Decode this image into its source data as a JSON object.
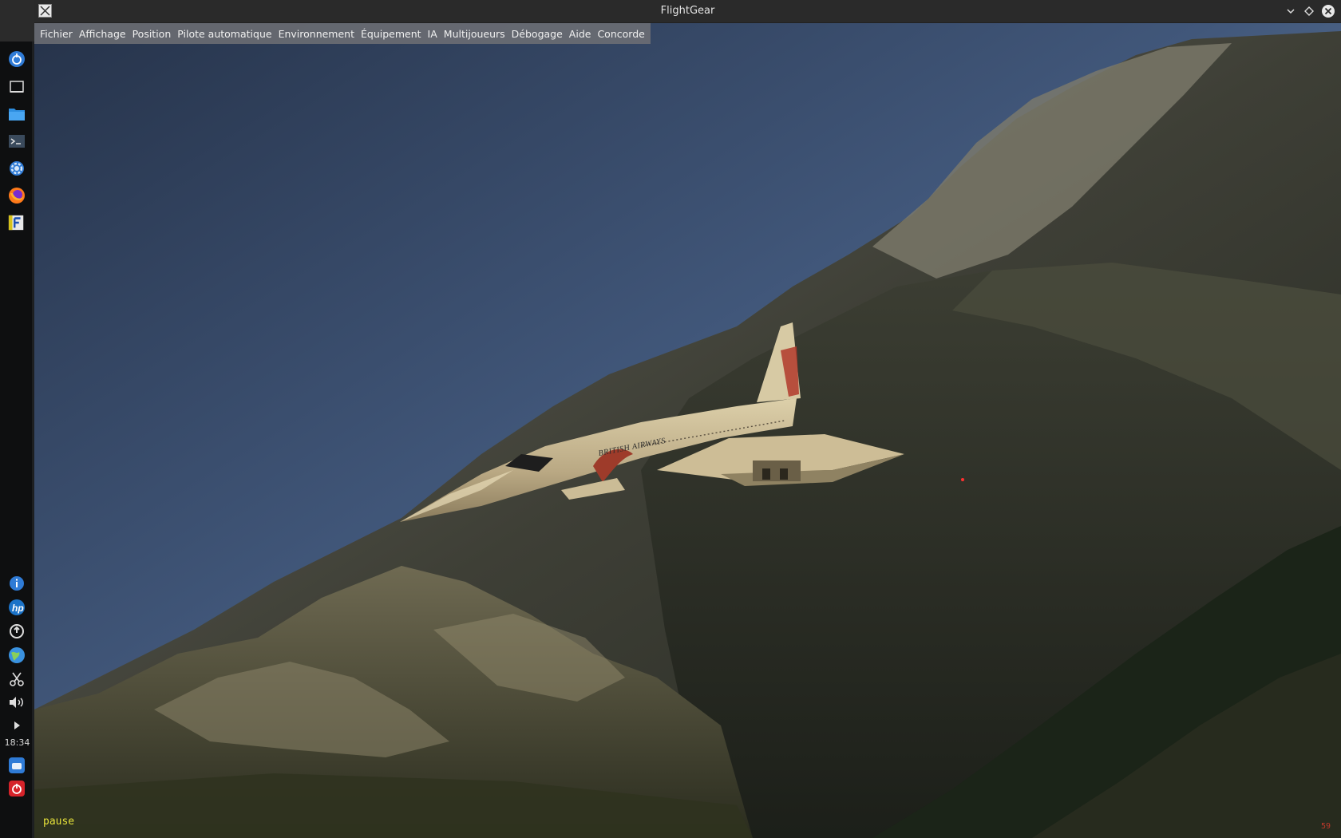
{
  "window": {
    "title": "FlightGear",
    "controls": [
      "minimize-icon",
      "maximize-icon",
      "close-icon"
    ]
  },
  "menubar": {
    "items": [
      "Fichier",
      "Affichage",
      "Position",
      "Pilote automatique",
      "Environnement",
      "Équipement",
      "IA",
      "Multijoueurs",
      "Débogage",
      "Aide",
      "Concorde"
    ]
  },
  "dock": {
    "clock": "18:34",
    "icons": [
      "app-menu-icon",
      "desktop-icon",
      "file-manager-icon",
      "terminal-icon",
      "settings-icon",
      "firefox-icon",
      "flightgear-icon",
      "info-icon",
      "hp-icon",
      "update-icon",
      "network-globe-icon",
      "scissors-icon",
      "volume-icon",
      "tray-expand-icon",
      "removable-drive-icon",
      "power-icon"
    ]
  },
  "scene": {
    "aircraft_livery_text": "BRITISH AIRWAYS"
  },
  "status": {
    "pause_text": "pause",
    "fps_text": "59"
  },
  "colors": {
    "sky_top": "#2b3a52",
    "sky_horizon": "#6d89ab",
    "menu_bg": "#6e7074",
    "pause_text": "#e6e23a",
    "fps_text": "#c0392b"
  }
}
